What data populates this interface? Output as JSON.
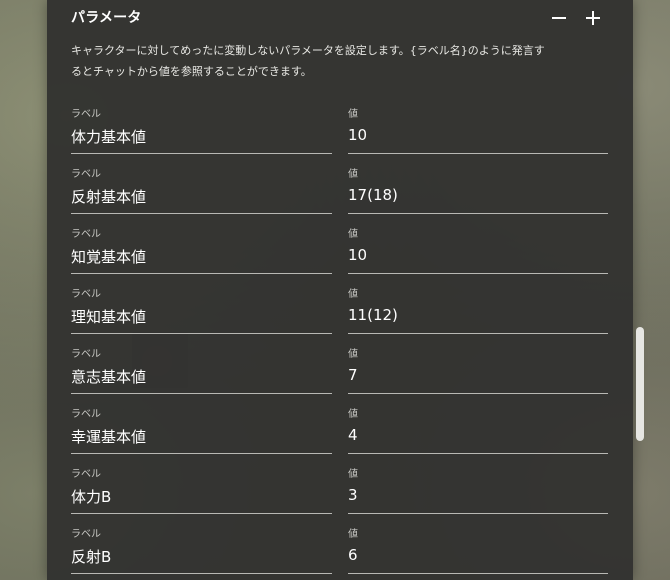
{
  "section": {
    "title": "パラメータ",
    "description_line1": "キャラクターに対してめったに変動しないパラメータを設定します。{ラベル名}のように発言す",
    "description_line2": "るとチャットから値を参照することができます。"
  },
  "captions": {
    "label": "ラベル",
    "value": "値"
  },
  "icons": {
    "remove": "minus-icon",
    "add": "plus-icon"
  },
  "params": [
    {
      "label": "体力基本値",
      "value": "10"
    },
    {
      "label": "反射基本値",
      "value": "17(18)"
    },
    {
      "label": "知覚基本値",
      "value": "10"
    },
    {
      "label": "理知基本値",
      "value": "11(12)"
    },
    {
      "label": "意志基本値",
      "value": "7"
    },
    {
      "label": "幸運基本値",
      "value": "4"
    },
    {
      "label": "体力B",
      "value": "3"
    },
    {
      "label": "反射B",
      "value": "6"
    }
  ]
}
